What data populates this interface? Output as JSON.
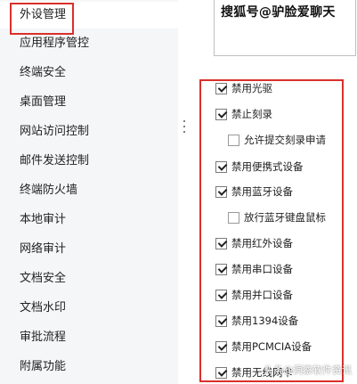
{
  "sidebar": {
    "items": [
      {
        "label": "外设管理",
        "active": true
      },
      {
        "label": "应用程序管控"
      },
      {
        "label": "终端安全"
      },
      {
        "label": "桌面管理"
      },
      {
        "label": "网站访问控制"
      },
      {
        "label": "邮件发送控制"
      },
      {
        "label": "终端防火墙"
      },
      {
        "label": "本地审计"
      },
      {
        "label": "网络审计"
      },
      {
        "label": "文档安全"
      },
      {
        "label": "文档水印"
      },
      {
        "label": "审批流程"
      },
      {
        "label": "附属功能"
      }
    ]
  },
  "preview": {
    "watermark_text": "搜狐号@驴脸爱聊天"
  },
  "options": [
    {
      "label": "禁用光驱",
      "checked": true,
      "indent": false
    },
    {
      "label": "禁止刻录",
      "checked": true,
      "indent": false
    },
    {
      "label": "允许提交刻录申请",
      "checked": false,
      "indent": true
    },
    {
      "label": "禁用便携式设备",
      "checked": true,
      "indent": false
    },
    {
      "label": "禁用蓝牙设备",
      "checked": true,
      "indent": false
    },
    {
      "label": "放行蓝牙键盘鼠标",
      "checked": false,
      "indent": true
    },
    {
      "label": "禁用红外设备",
      "checked": true,
      "indent": false
    },
    {
      "label": "禁用串口设备",
      "checked": true,
      "indent": false
    },
    {
      "label": "禁用并口设备",
      "checked": true,
      "indent": false
    },
    {
      "label": "禁用1394设备",
      "checked": true,
      "indent": false
    },
    {
      "label": "禁用PCMCIA设备",
      "checked": true,
      "indent": false
    },
    {
      "label": "禁用无线网卡",
      "checked": true,
      "indent": false
    }
  ],
  "footer": {
    "watermark_text": "头条@洞察软件资讯"
  },
  "colors": {
    "highlight_border": "#d9302c",
    "sidebar_bg": "#f5f6f8"
  }
}
